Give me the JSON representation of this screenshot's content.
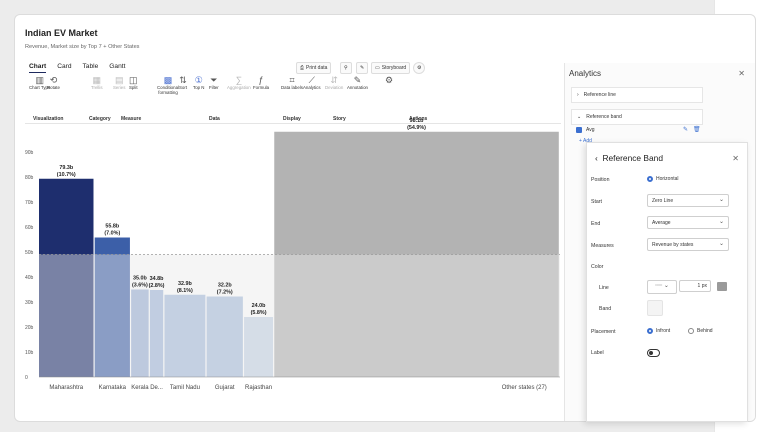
{
  "app": {
    "title": "Indian EV Market",
    "subtitle": "Revenue, Market size by Top 7 + Other States"
  },
  "tabs": [
    "Chart",
    "Card",
    "Table",
    "Gantt"
  ],
  "top_buttons": {
    "print": "Print data",
    "storyboard": "Storyboard"
  },
  "ribbon": {
    "buttons": [
      {
        "label": "Chart Type",
        "icon": "bar-chart-icon",
        "glyph": "▥",
        "dim": false
      },
      {
        "label": "Rotate",
        "icon": "rotate-icon",
        "glyph": "⟲",
        "dim": false
      },
      {
        "label": "Trellis",
        "icon": "trellis-icon",
        "glyph": "▦",
        "dim": true
      },
      {
        "label": "Series",
        "icon": "series-icon",
        "glyph": "▤",
        "dim": true
      },
      {
        "label": "Split",
        "icon": "split-icon",
        "glyph": "◫",
        "dim": false
      },
      {
        "label": "Conditional formatting",
        "icon": "conditional-formatting-icon",
        "glyph": "▩",
        "dim": false
      },
      {
        "label": "Sort",
        "icon": "sort-icon",
        "glyph": "⇅",
        "dim": false
      },
      {
        "label": "Top N",
        "icon": "top-n-icon",
        "glyph": "①",
        "dim": false
      },
      {
        "label": "Filter",
        "icon": "filter-icon",
        "glyph": "⏷",
        "dim": false
      },
      {
        "label": "Aggregation",
        "icon": "aggregation-icon",
        "glyph": "∑",
        "dim": true
      },
      {
        "label": "Formula",
        "icon": "formula-icon",
        "glyph": "ƒ",
        "dim": false
      },
      {
        "label": "Data labels",
        "icon": "data-labels-icon",
        "glyph": "⌗",
        "dim": false
      },
      {
        "label": "Analytics",
        "icon": "analytics-icon",
        "glyph": "⟋",
        "dim": false
      },
      {
        "label": "Deviation",
        "icon": "deviation-icon",
        "glyph": "⇵",
        "dim": true
      },
      {
        "label": "Annotation",
        "icon": "annotation-icon",
        "glyph": "✎",
        "dim": false
      },
      {
        "label": "",
        "icon": "actions-icon",
        "glyph": "⚙",
        "dim": false
      }
    ],
    "groups": [
      "Visualization",
      "Category",
      "Measure",
      "Data",
      "Display",
      "Story",
      "Actions"
    ]
  },
  "chart_data": {
    "type": "bar",
    "title": "Indian EV Market",
    "subtitle": "Revenue, Market size by Top 7 + Other States",
    "categories": [
      "Maharashtra",
      "Karnataka",
      "Kerala",
      "De...",
      "Tamil Nadu",
      "Gujarat",
      "Rajasthan",
      "Other states (27)"
    ],
    "values": [
      79.3,
      55.8,
      35.0,
      34.8,
      32.9,
      32.2,
      24.0,
      98.1
    ],
    "widths_pct": [
      10.7,
      7.0,
      3.6,
      2.8,
      8.1,
      7.2,
      5.8,
      54.9
    ],
    "value_labels": [
      "79.3b",
      "55.8b",
      "35.0b",
      "34.8b",
      "32.9b",
      "32.2b",
      "24.0b",
      "98.1b"
    ],
    "pct_labels": [
      "(10.7%)",
      "(7.0%)",
      "(3.6%)",
      "(2.8%)",
      "(8.1%)",
      "(7.2%)",
      "(5.8%)",
      "(54.9%)"
    ],
    "colors": [
      "#1e2e6e",
      "#3c5fa8",
      "#9ab0d6",
      "#a0b6da",
      "#a6bcdc",
      "#a8bedc",
      "#c5d4e6",
      "#b3b3b3"
    ],
    "y_ticks": [
      "0",
      "10b",
      "20b",
      "30b",
      "40b",
      "50b",
      "60b",
      "70b",
      "80b",
      "90b"
    ],
    "ylim": [
      0,
      90
    ],
    "reference_band": {
      "start": "Zero Line",
      "end": "Average",
      "value": 49.0
    }
  },
  "analytics": {
    "title": "Analytics",
    "rows": [
      "Reference line",
      "Reference band"
    ],
    "band_item": "Avg",
    "add": "+ Add"
  },
  "reference_band_panel": {
    "title": "Reference Band",
    "position_label": "Position",
    "position_value": "Horizontal",
    "start_label": "Start",
    "start_value": "Zero Line",
    "end_label": "End",
    "end_value": "Average",
    "measures_label": "Measures",
    "measures_value": "Revenue by states",
    "color_label": "Color",
    "line_label": "Line",
    "line_width": "1 px",
    "band_label": "Band",
    "placement_label": "Placement",
    "placement_infront": "Infront",
    "placement_behind": "Behind",
    "label_label": "Label",
    "line_color": "#9a9a9a"
  }
}
